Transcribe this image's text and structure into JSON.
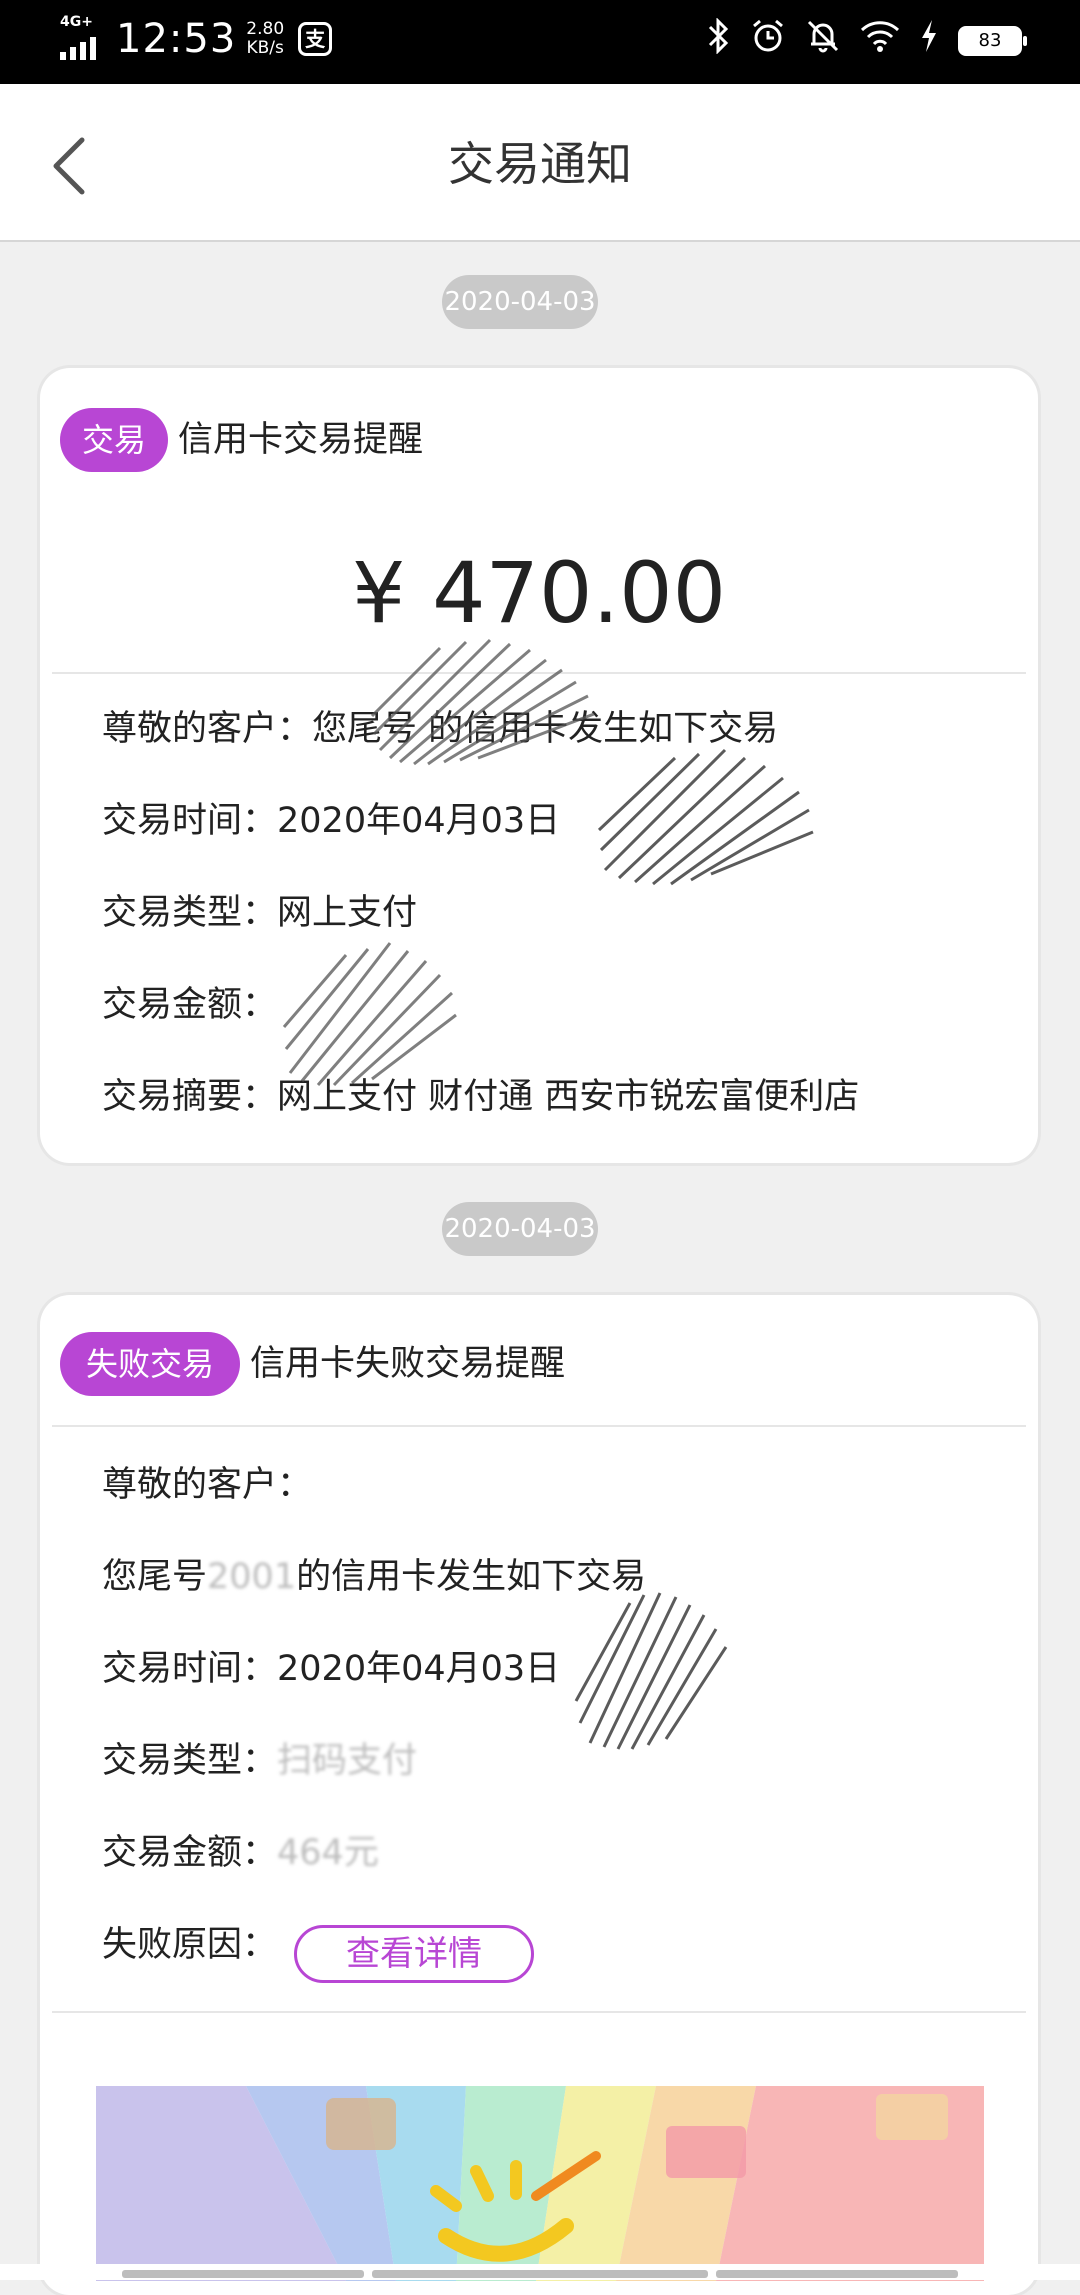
{
  "status_bar": {
    "network": "4G+",
    "time": "12:53",
    "speed_value": "2.80",
    "speed_unit": "KB/s",
    "app_icon": "支",
    "battery": "83"
  },
  "header": {
    "title": "交易通知"
  },
  "messages": [
    {
      "date": "2020-04-03",
      "badge": "交易",
      "title": "信用卡交易提醒",
      "amount": "¥ 470.00",
      "rows": [
        {
          "label": "尊敬的客户：",
          "value": "您尾号 的信用卡发生如下交易"
        },
        {
          "label": "交易时间：",
          "value": "2020年04月03日"
        },
        {
          "label": "交易类型：",
          "value": "网上支付"
        },
        {
          "label": "交易金额：",
          "value": ""
        },
        {
          "label": "交易摘要：",
          "value": "网上支付 财付通 西安市锐宏富便利店"
        }
      ]
    },
    {
      "date": "2020-04-03",
      "badge": "失败交易",
      "title": "信用卡失败交易提醒",
      "greeting": "尊敬的客户：",
      "line2": "您尾号",
      "line2_masked": "2001",
      "line2_end": "的信用卡发生如下交易",
      "rows": [
        {
          "label": "交易时间：",
          "value": "2020年04月03日"
        },
        {
          "label": "交易类型：",
          "value": "扫码支付"
        },
        {
          "label": "交易金额：",
          "value": "464元"
        }
      ],
      "fail_reason_label": "失败原因：",
      "detail_button": "查看详情"
    }
  ]
}
